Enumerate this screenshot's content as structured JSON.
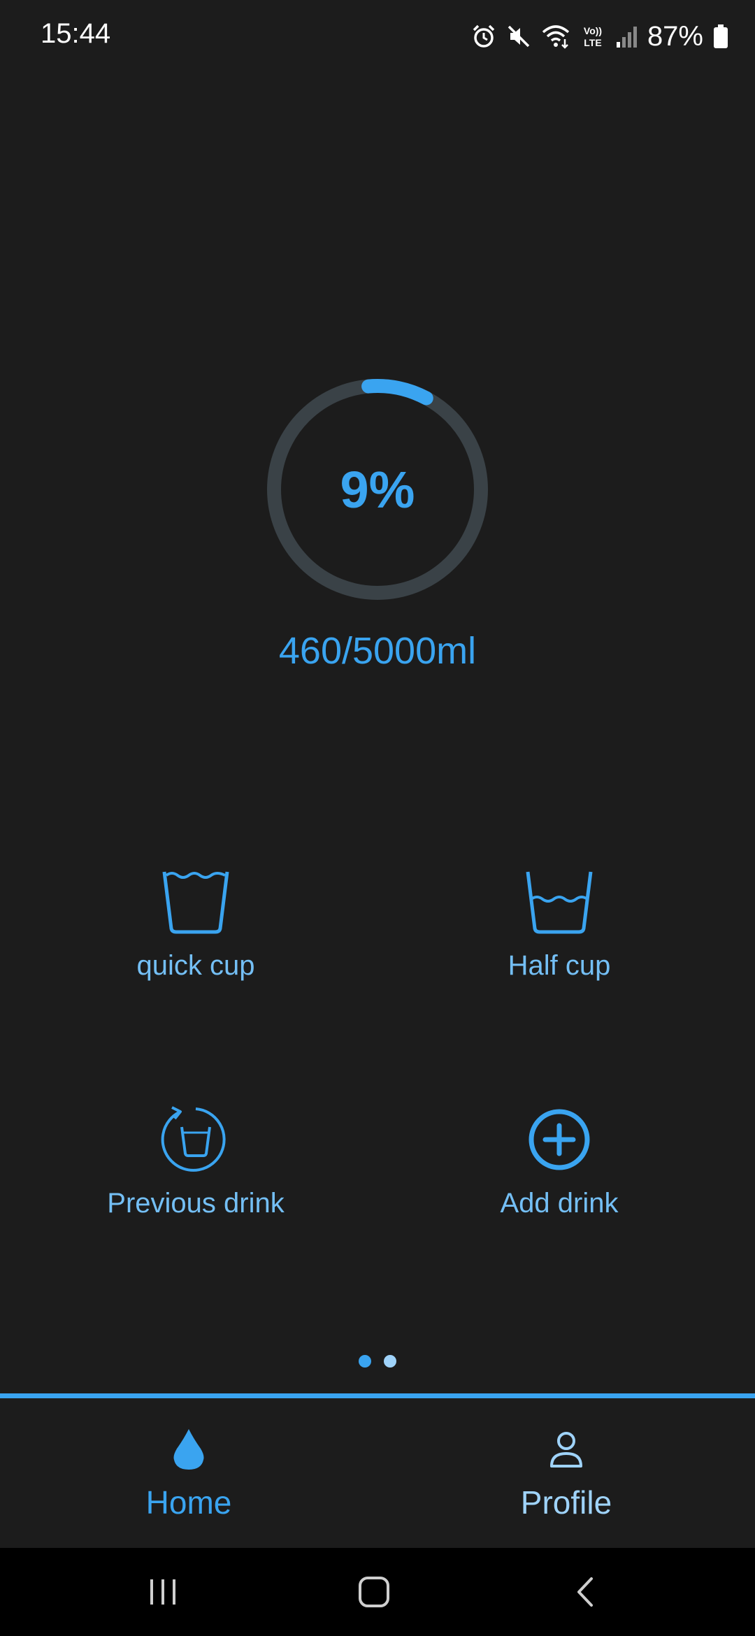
{
  "status_bar": {
    "time": "15:44",
    "icons": [
      "alarm-icon",
      "mute-icon",
      "wifi-icon",
      "volte-icon",
      "signal-icon",
      "battery-icon"
    ],
    "battery_percent": "87%"
  },
  "progress": {
    "percent_label": "9%",
    "fraction": 0.092,
    "intake_label": "460/5000ml"
  },
  "actions": [
    {
      "label": "quick cup",
      "icon": "full-cup-icon"
    },
    {
      "label": "Half cup",
      "icon": "half-cup-icon"
    },
    {
      "label": "Previous drink",
      "icon": "repeat-drink-icon"
    },
    {
      "label": "Add drink",
      "icon": "add-circle-icon"
    }
  ],
  "pager": {
    "pages": 2,
    "active_index": 0
  },
  "bottom_nav": {
    "items": [
      {
        "label": "Home",
        "icon": "water-drop-icon",
        "active": true
      },
      {
        "label": "Profile",
        "icon": "person-icon",
        "active": false
      }
    ]
  },
  "system_nav": {
    "buttons": [
      "recent-apps-icon",
      "home-icon",
      "back-icon"
    ]
  },
  "colors": {
    "background": "#1c1c1c",
    "accent": "#3aa4f0",
    "accent_light": "#74bff5",
    "ring_track": "#3a4247"
  }
}
